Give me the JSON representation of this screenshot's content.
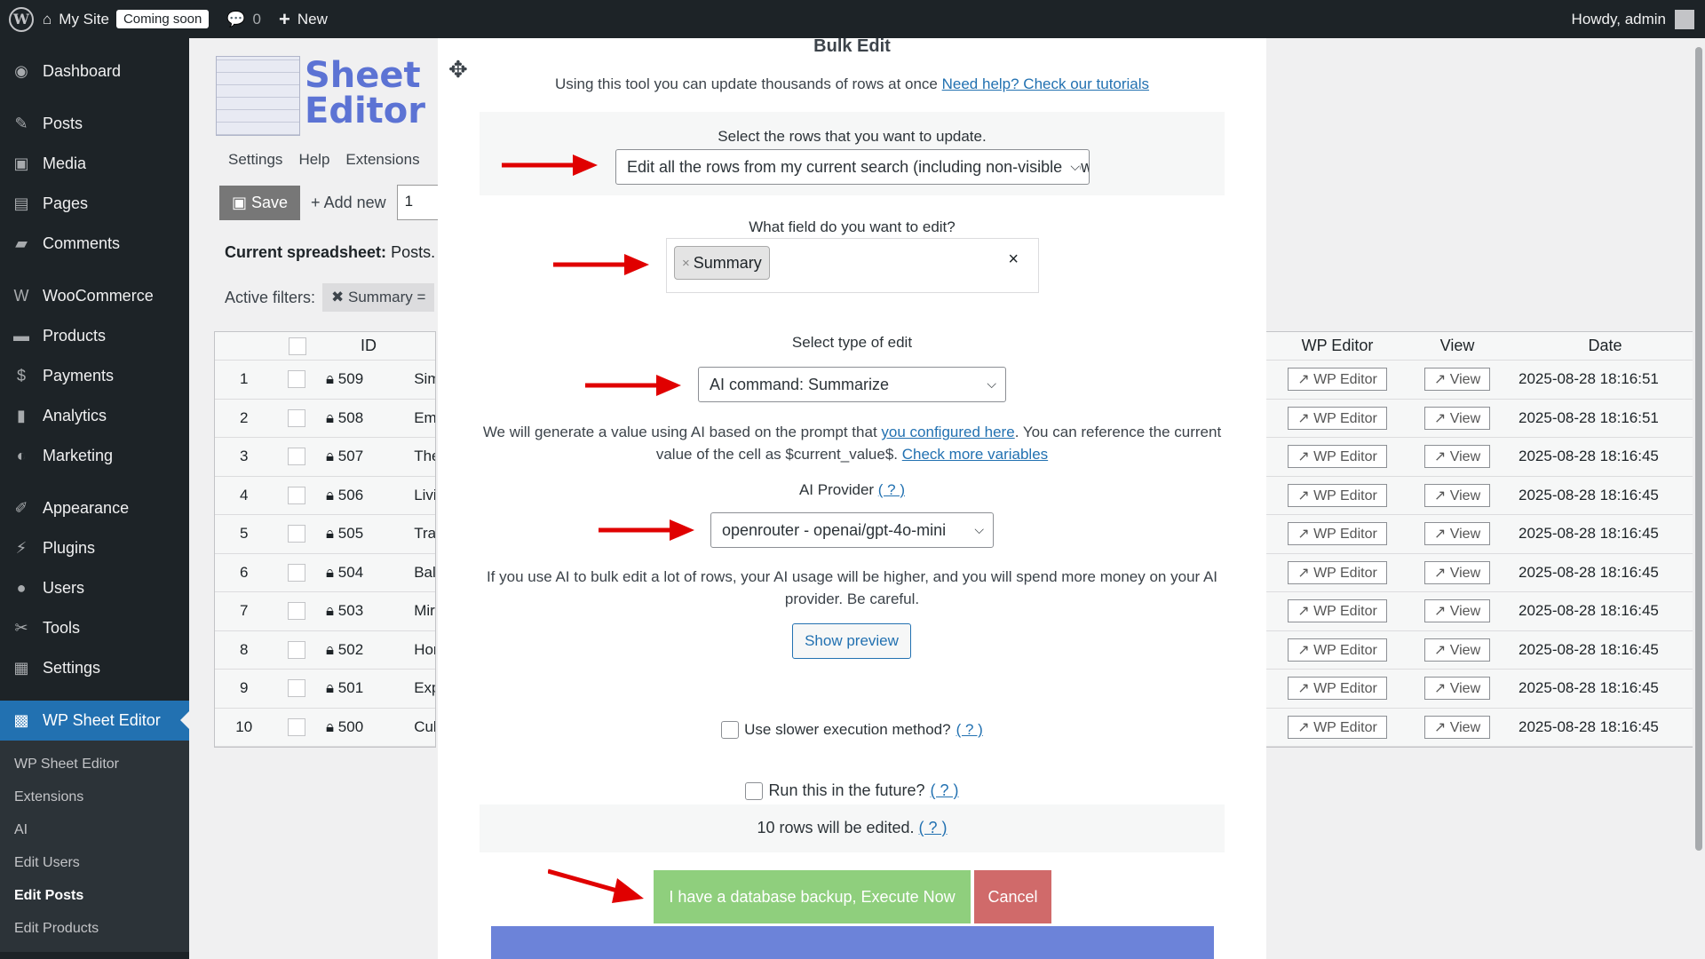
{
  "adminbar": {
    "site_name": "My Site",
    "coming_soon": "Coming soon",
    "comments_count": "0",
    "new_label": "New",
    "howdy": "Howdy, admin"
  },
  "sidebar": {
    "items": [
      {
        "label": "Dashboard",
        "icon": "dashboard-icon"
      },
      {
        "label": "Posts",
        "icon": "pin-icon"
      },
      {
        "label": "Media",
        "icon": "media-icon"
      },
      {
        "label": "Pages",
        "icon": "pages-icon"
      },
      {
        "label": "Comments",
        "icon": "comment-icon"
      },
      {
        "label": "WooCommerce",
        "icon": "woo-icon"
      },
      {
        "label": "Products",
        "icon": "archive-icon"
      },
      {
        "label": "Payments",
        "icon": "dollar-icon"
      },
      {
        "label": "Analytics",
        "icon": "bar-chart-icon"
      },
      {
        "label": "Marketing",
        "icon": "megaphone-icon"
      },
      {
        "label": "Appearance",
        "icon": "brush-icon"
      },
      {
        "label": "Plugins",
        "icon": "plug-icon"
      },
      {
        "label": "Users",
        "icon": "user-icon"
      },
      {
        "label": "Tools",
        "icon": "wrench-icon"
      },
      {
        "label": "Settings",
        "icon": "settings-icon"
      },
      {
        "label": "WP Sheet Editor",
        "icon": "sheet-editor-icon"
      }
    ],
    "submenu": [
      "WP Sheet Editor",
      "Extensions",
      "AI",
      "Edit Users",
      "Edit Posts",
      "Edit Products"
    ]
  },
  "background": {
    "logo_line1": "Sheet",
    "logo_line2": "Editor",
    "tabs": [
      "Settings",
      "Help",
      "Extensions"
    ],
    "save_label": "Save",
    "add_new_label": "Add new",
    "number_value": "1",
    "current_spreadsheet_label": "Current spreadsheet:",
    "current_spreadsheet_value": "Posts. F",
    "active_filters_label": "Active filters:",
    "filter_chip": "Summary =",
    "headers": {
      "id": "ID",
      "wp_editor": "WP Editor",
      "view": "View",
      "date": "Date"
    },
    "rows": [
      {
        "num": "1",
        "id": "509",
        "title": "Sim",
        "date": "2025-08-28 18:16:51"
      },
      {
        "num": "2",
        "id": "508",
        "title": "Em",
        "date": "2025-08-28 18:16:51"
      },
      {
        "num": "3",
        "id": "507",
        "title": "The",
        "date": "2025-08-28 18:16:45"
      },
      {
        "num": "4",
        "id": "506",
        "title": "Livi",
        "date": "2025-08-28 18:16:45"
      },
      {
        "num": "5",
        "id": "505",
        "title": "Tra",
        "date": "2025-08-28 18:16:45"
      },
      {
        "num": "6",
        "id": "504",
        "title": "Bal",
        "date": "2025-08-28 18:16:45"
      },
      {
        "num": "7",
        "id": "503",
        "title": "Mir",
        "date": "2025-08-28 18:16:45"
      },
      {
        "num": "8",
        "id": "502",
        "title": "Hor",
        "date": "2025-08-28 18:16:45"
      },
      {
        "num": "9",
        "id": "501",
        "title": "Exp",
        "date": "2025-08-28 18:16:45"
      },
      {
        "num": "10",
        "id": "500",
        "title": "Cul",
        "date": "2025-08-28 18:16:45"
      }
    ],
    "wp_editor_btn": "WP Editor",
    "view_btn": "View"
  },
  "modal": {
    "title": "Bulk Edit",
    "intro_text": "Using this tool you can update thousands of rows at once",
    "intro_link": "Need help? Check our tutorials",
    "rows_label": "Select the rows that you want to update.",
    "rows_select": "Edit all the rows from my current search (including non-visible rows)",
    "field_label": "What field do you want to edit?",
    "field_token": "Summary",
    "edit_type_label": "Select type of edit",
    "edit_type_select": "AI command: Summarize",
    "ai_desc_1": "We will generate a value using AI based on the prompt that",
    "ai_desc_link1": "you configured here",
    "ai_desc_2": ". You can reference the current value of the cell as $current_value$.",
    "ai_desc_link2": "Check more variables",
    "provider_label": "AI Provider",
    "help_link": "( ? )",
    "provider_select": "openrouter - openai/gpt-4o-mini",
    "warning": "If you use AI to bulk edit a lot of rows, your AI usage will be higher, and you will spend more money on your AI provider. Be careful.",
    "preview_btn": "Show preview",
    "slower_label": "Use slower execution method?",
    "future_label": "Run this in the future?",
    "rows_edited": "10 rows will be edited.",
    "execute_btn": "I have a database backup, Execute Now",
    "cancel_btn": "Cancel"
  },
  "colors": {
    "admin_dark": "#1d2327",
    "wp_blue": "#2271b1",
    "execute_green": "#8fcf7d",
    "cancel_red": "#d06a6a",
    "arrow_red": "#e00000",
    "logo_blue": "#5c73d4"
  }
}
